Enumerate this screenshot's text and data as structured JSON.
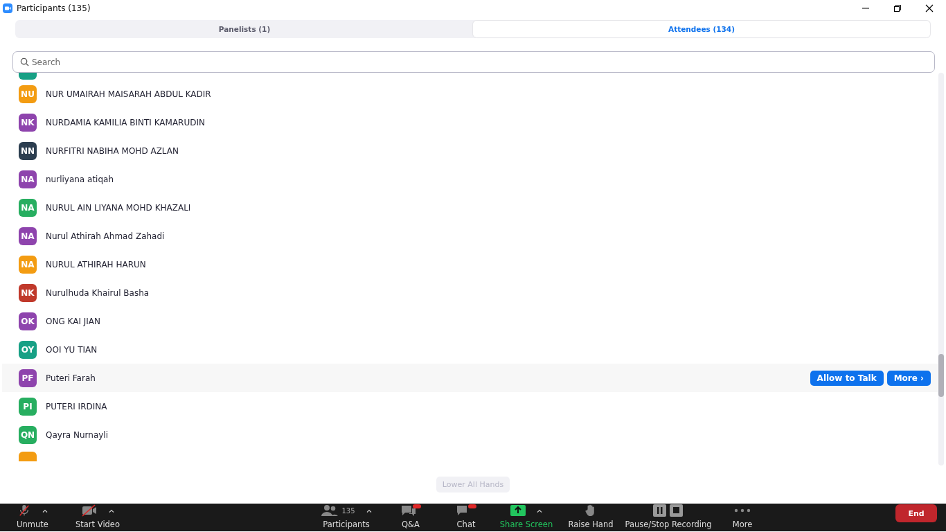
{
  "window": {
    "title": "Participants (135)"
  },
  "tabs": [
    {
      "label": "Panelists (1)",
      "selected": false
    },
    {
      "label": "Attendees (134)",
      "selected": true
    }
  ],
  "search": {
    "placeholder": "Search"
  },
  "attendees": [
    {
      "kind": "partial",
      "color": "#17a085"
    },
    {
      "initials": "NU",
      "name": "NUR UMAIRAH MAISARAH ABDUL KADIR",
      "color": "#f39c12",
      "hovered": false
    },
    {
      "initials": "NK",
      "name": "NURDAMIA KAMILIA BINTI KAMARUDIN",
      "color": "#8e44ad",
      "hovered": false
    },
    {
      "initials": "NN",
      "name": "NURFITRI NABIHA MOHD AZLAN",
      "color": "#2c3e50",
      "hovered": false
    },
    {
      "initials": "NA",
      "name": "nurliyana atiqah",
      "color": "#8e44ad",
      "hovered": false
    },
    {
      "initials": "NA",
      "name": "NURUL AIN LIYANA MOHD KHAZALI",
      "color": "#27ae60",
      "hovered": false
    },
    {
      "initials": "NA",
      "name": "Nurul Athirah Ahmad Zahadi",
      "color": "#8e44ad",
      "hovered": false
    },
    {
      "initials": "NA",
      "name": "NURUL ATHIRAH HARUN",
      "color": "#f39c12",
      "hovered": false
    },
    {
      "initials": "NK",
      "name": "Nurulhuda Khairul Basha",
      "color": "#c0392b",
      "hovered": false
    },
    {
      "initials": "OK",
      "name": "ONG KAI JIAN",
      "color": "#8e44ad",
      "hovered": false
    },
    {
      "initials": "OY",
      "name": "OOI YU TIAN",
      "color": "#17a085",
      "hovered": false
    },
    {
      "initials": "PF",
      "name": "Puteri Farah",
      "color": "#8e44ad",
      "hovered": true,
      "actions": [
        "Allow to Talk",
        "More ›"
      ]
    },
    {
      "initials": "PI",
      "name": "PUTERI IRDINA",
      "color": "#27ae60",
      "hovered": false
    },
    {
      "initials": "QN",
      "name": "Qayra Nurnayli",
      "color": "#27ae60",
      "hovered": false
    },
    {
      "kind": "partial",
      "color": "#f39c12"
    }
  ],
  "lower_all_hands": {
    "label": "Lower All Hands",
    "disabled": true
  },
  "toolbar": [
    {
      "kind": "mic",
      "label": "Unmute",
      "caret": true
    },
    {
      "kind": "video",
      "label": "Start Video",
      "caret": true
    },
    {
      "kind": "participants",
      "label": "Participants",
      "count": "135",
      "caret": true
    },
    {
      "kind": "qa",
      "label": "Q&A",
      "badge": true
    },
    {
      "kind": "chat",
      "label": "Chat",
      "badge": true
    },
    {
      "kind": "share",
      "label": "Share Screen",
      "caret": true
    },
    {
      "kind": "hand",
      "label": "Raise Hand"
    },
    {
      "kind": "record",
      "label": "Pause/Stop Recording"
    },
    {
      "kind": "more",
      "label": "More"
    }
  ],
  "end_button": {
    "label": "End"
  }
}
